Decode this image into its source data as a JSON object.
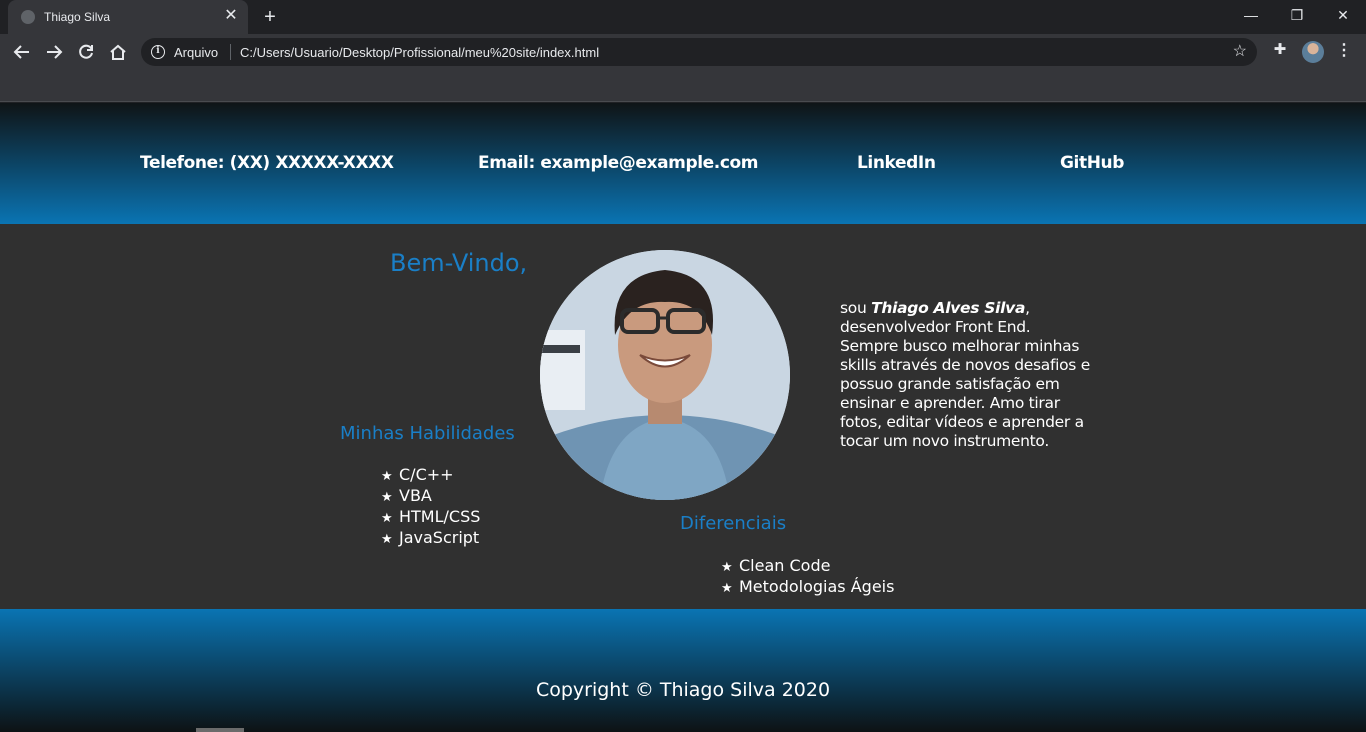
{
  "browser": {
    "tab_title": "Thiago Silva",
    "tab_close": "✕",
    "new_tab": "+",
    "address_scheme": "Arquivo",
    "url": "C:/Users/Usuario/Desktop/Profissional/meu%20site/index.html"
  },
  "header": {
    "phone": "Telefone: (XX) XXXXX-XXXX",
    "email": "Email: example@example.com",
    "linkedin": "LinkedIn",
    "github": "GitHub"
  },
  "main": {
    "welcome": "Bem-Vindo,",
    "bio_prefix": "sou ",
    "bio_name": "Thiago Alves Silva",
    "bio_text": ", desenvolvedor Front End. Sempre busco melhorar minhas skills através de novos desafios e possuo grande satisfação em ensinar e aprender. Amo tirar fotos, editar vídeos e aprender a tocar um novo instrumento."
  },
  "skills": {
    "title": "Minhas Habilidades",
    "items": [
      "C/C++",
      "VBA",
      "HTML/CSS",
      "JavaScript"
    ]
  },
  "differentials": {
    "title": "Diferenciais",
    "items": [
      "Clean Code",
      "Metodologias Ágeis"
    ]
  },
  "footer": {
    "copyright": "Copyright © Thiago Silva 2020"
  },
  "colors": {
    "accent": "#1a7fc7",
    "page_bg": "#303030",
    "header_gradient_top": "#0f1416",
    "header_gradient_bottom": "#0a74b3"
  }
}
